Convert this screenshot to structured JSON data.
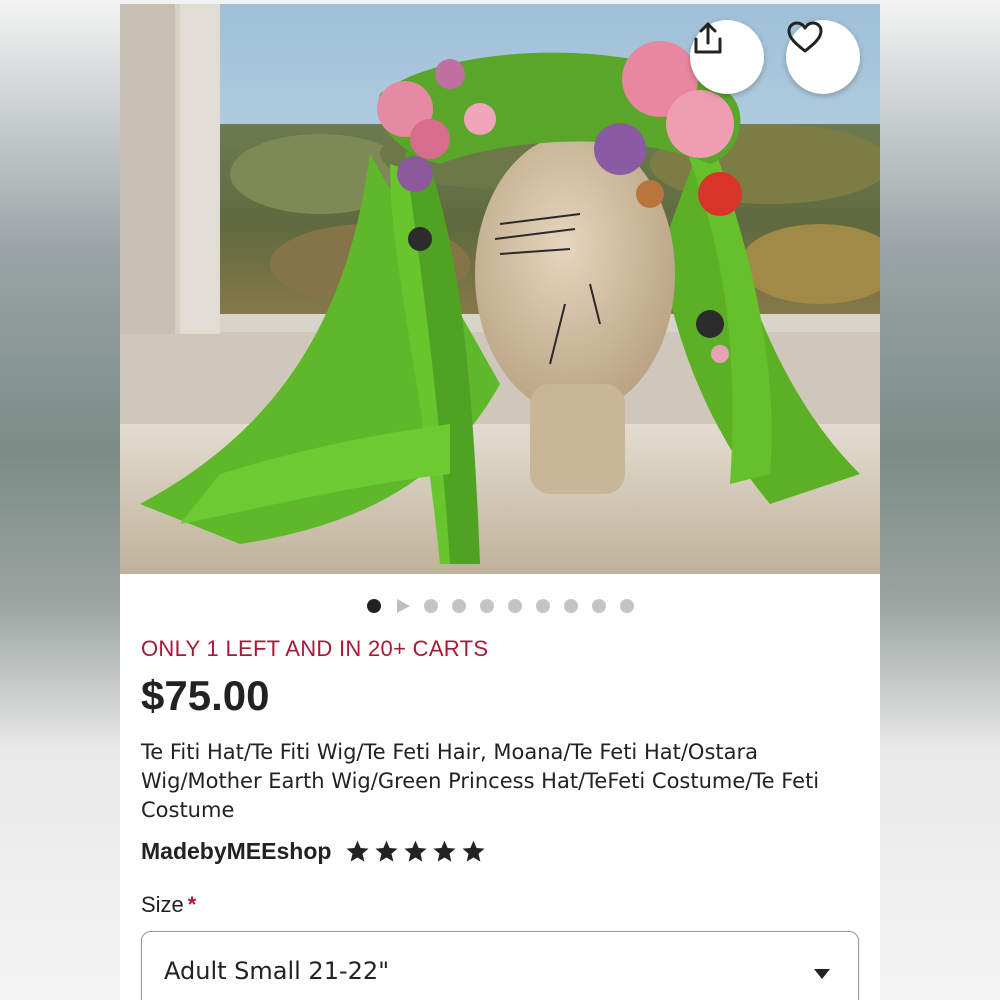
{
  "listing": {
    "stock_notice": "ONLY 1 LEFT AND IN 20+ CARTS",
    "price": "$75.00",
    "title": "Te Fiti Hat/Te Fiti Wig/Te Feti Hair, Moana/Te Feti Hat/Ostara Wig/Mother Earth Wig/Green Princess Hat/TeFeti Costume/Te Feti Costume",
    "shop_name": "MadebyMEEshop",
    "rating_stars": 5
  },
  "image_carousel": {
    "total_slides": 10,
    "active_index": 0,
    "video_slide_index": 1
  },
  "actions": {
    "share_icon": "share-icon",
    "favorite_icon": "heart-icon"
  },
  "variation": {
    "label": "Size",
    "required_marker": "*",
    "selected_value": "Adult Small 21-22\""
  },
  "colors": {
    "accent_red": "#a61a37",
    "text_primary": "#222222",
    "dot_active": "#222222",
    "dot_inactive": "#c4c4c4",
    "wig_green": "#6cc42a"
  }
}
